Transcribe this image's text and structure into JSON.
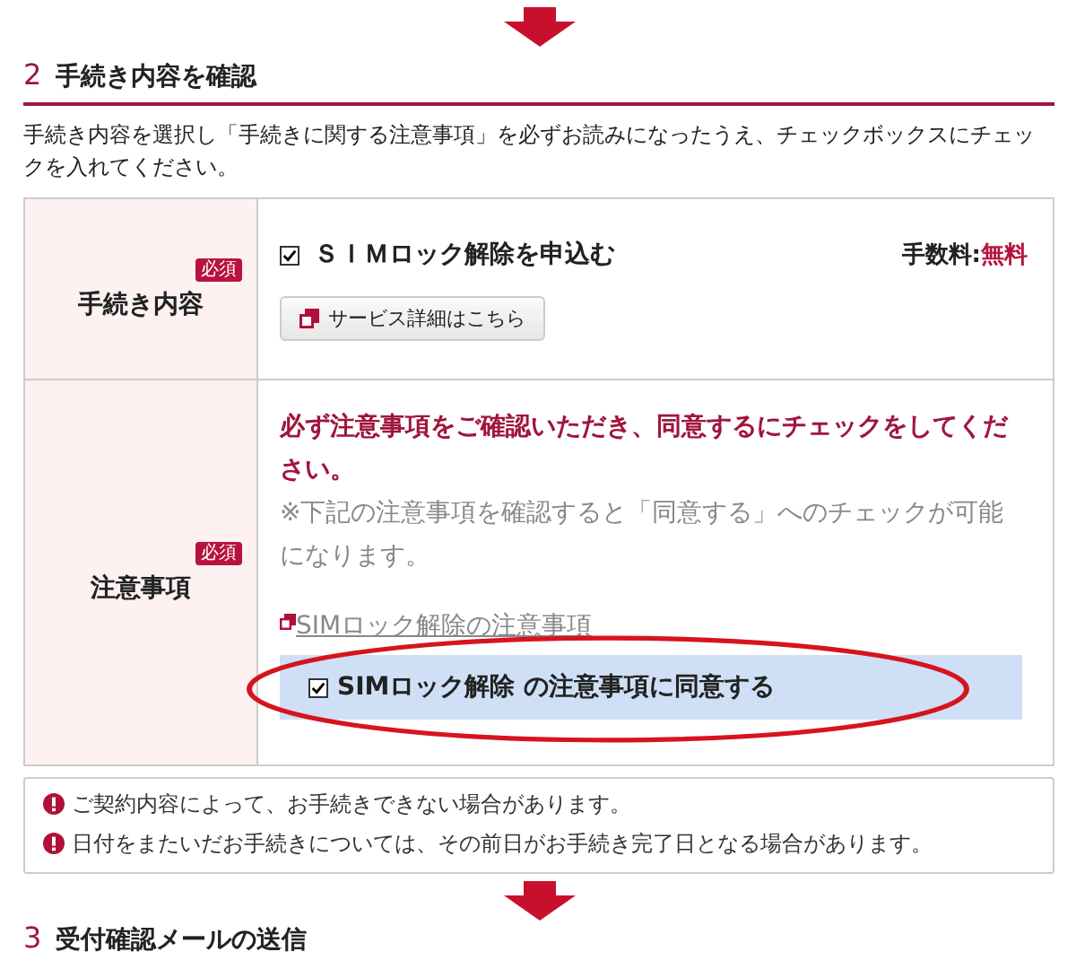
{
  "section": {
    "number": "2",
    "title": "手続き内容を確認"
  },
  "intro": "手続き内容を選択し「手続きに関する注意事項」を必ずお読みになったうえ、チェックボックスにチェックを入れてください。",
  "procedure_row": {
    "label": "手続き内容",
    "badge": "必須",
    "option": {
      "label": "ＳＩＭロック解除を申込む",
      "checked": true
    },
    "fee_label": "手数料:",
    "fee_value": "無料",
    "detail_button": "サービス詳細はこちら"
  },
  "notes_row": {
    "label": "注意事項",
    "badge": "必須",
    "warning": "必ず注意事項をご確認いただき、同意するにチェックをしてください。",
    "hint": "※下記の注意事項を確認すると「同意する」へのチェックが可能になります。",
    "link": "SIMロック解除の注意事項",
    "agree": {
      "label": "SIMロック解除 の注意事項に同意する",
      "checked": true
    }
  },
  "notices": [
    "ご契約内容によって、お手続きできない場合があります。",
    "日付をまたいだお手続きについては、その前日がお手続き完了日となる場合があります。"
  ],
  "next_section": {
    "number": "3",
    "title": "受付確認メールの送信"
  }
}
